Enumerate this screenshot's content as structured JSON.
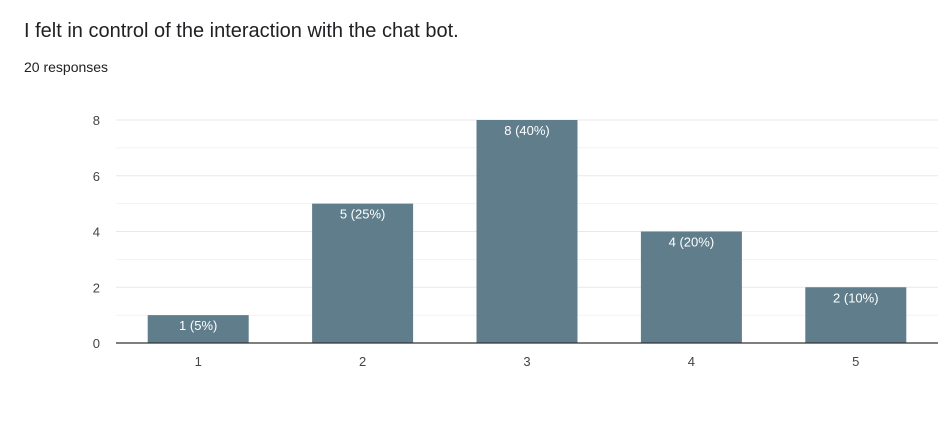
{
  "question": {
    "title": "I felt in control of the interaction with the chat bot.",
    "responses_label": "20 responses"
  },
  "colors": {
    "bar": "#607d8b",
    "bar_label": "#ffffff",
    "grid": "#e8e8e8",
    "baseline": "#333333",
    "tick_text": "#444444"
  },
  "chart_data": {
    "type": "bar",
    "categories": [
      "1",
      "2",
      "3",
      "4",
      "5"
    ],
    "values": [
      1,
      5,
      8,
      4,
      2
    ],
    "data_labels": [
      "1 (5%)",
      "5 (25%)",
      "8 (40%)",
      "4 (20%)",
      "2 (10%)"
    ],
    "title": "",
    "xlabel": "",
    "ylabel": "",
    "ylim": [
      0,
      8
    ],
    "yticks": [
      0,
      2,
      4,
      6,
      8
    ],
    "grid": true,
    "legend": "none"
  }
}
